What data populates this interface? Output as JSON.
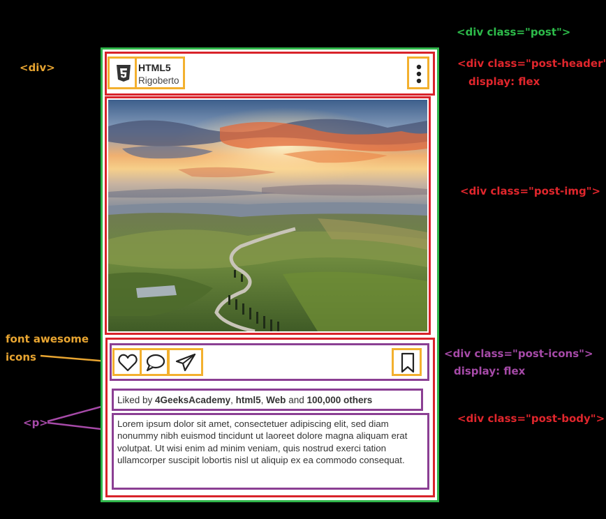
{
  "annotations": {
    "div_generic": "<div>",
    "post": "<div class=\"post\">",
    "post_header": "<div class=\"post-header\":",
    "post_header_display": "display: flex",
    "post_img": "<div class=\"post-img\">",
    "font_awesome_line1": "font awesome",
    "font_awesome_line2": "icons",
    "post_icons": "<div class=\"post-icons\">",
    "post_icons_display": "display: flex",
    "paragraph": "<p>",
    "post_body": "<div class=\"post-body\">"
  },
  "post": {
    "header": {
      "logo_icon": "html5-icon",
      "title": "HTML5",
      "subtitle": "Rigoberto",
      "menu_icon": "vertical-dots-icon"
    },
    "image_icon": "landscape-photo",
    "icons": [
      "heart-icon",
      "comment-icon",
      "paper-plane-icon",
      "bookmark-icon"
    ],
    "likes": {
      "prefix": "Liked by ",
      "user1": "4GeeksAcademy",
      "sep1": ", ",
      "user2": "html5",
      "sep2": ", ",
      "user3": "Web",
      "and": " and ",
      "others": "100,000 others"
    },
    "body_text": "Lorem ipsum dolor sit amet, consectetuer adipiscing elit, sed diam nonummy nibh euismod tincidunt ut laoreet dolore magna aliquam erat volutpat. Ut wisi enim ad minim veniam, quis nostrud exerci tation ullamcorper suscipit lobortis nisl ut aliquip ex ea commodo consequat."
  },
  "colors": {
    "post_border": "#2fb54a",
    "section_border": "#d8232a",
    "icon_border": "#f3b02e",
    "p_border": "#8b3f93",
    "background": "#000000"
  }
}
